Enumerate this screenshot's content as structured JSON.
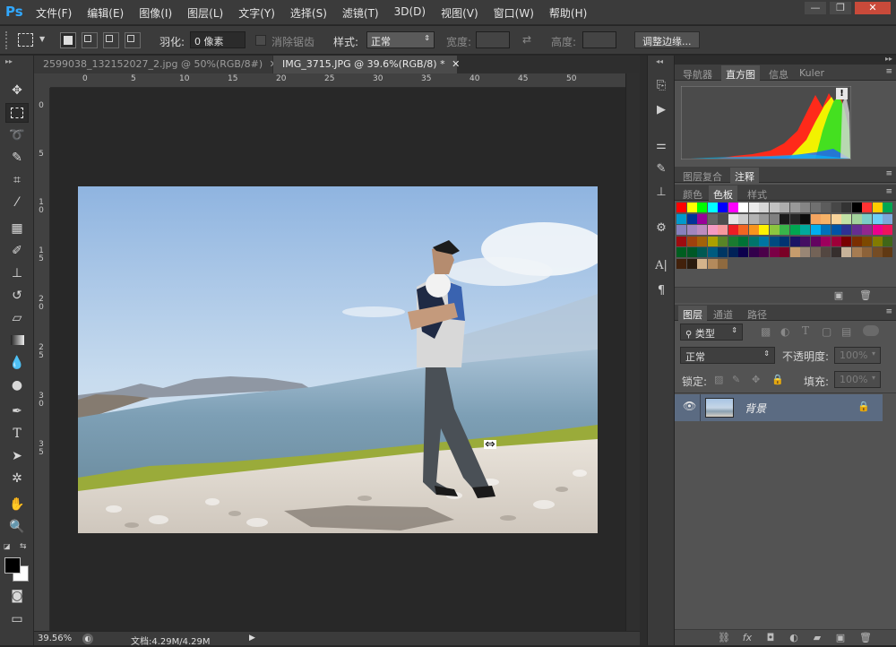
{
  "app": {
    "logo": "Ps"
  },
  "menu": [
    "文件(F)",
    "编辑(E)",
    "图像(I)",
    "图层(L)",
    "文字(Y)",
    "选择(S)",
    "滤镜(T)",
    "3D(D)",
    "视图(V)",
    "窗口(W)",
    "帮助(H)"
  ],
  "window_controls": {
    "minimize": "—",
    "restore": "❐",
    "close": "✕"
  },
  "options": {
    "feather_label": "羽化:",
    "feather_value": "0 像素",
    "antialias_label": "消除锯齿",
    "style_label": "样式:",
    "style_value": "正常",
    "width_label": "宽度:",
    "height_label": "高度:",
    "refine_button": "调整边缘..."
  },
  "doc_tabs": [
    {
      "label": "2599038_132152027_2.jpg @ 50%(RGB/8#)",
      "close": "✕",
      "active": false
    },
    {
      "label": "IMG_3715.JPG @ 39.6%(RGB/8) *",
      "close": "✕",
      "active": true
    }
  ],
  "ruler_h": [
    "0",
    "5",
    "10",
    "15",
    "20",
    "25",
    "30",
    "35",
    "40",
    "45",
    "50"
  ],
  "ruler_v": [
    [
      "0"
    ],
    [
      "5"
    ],
    [
      "1",
      "0"
    ],
    [
      "1",
      "5"
    ],
    [
      "2",
      "0"
    ],
    [
      "2",
      "5"
    ],
    [
      "3",
      "0"
    ],
    [
      "3",
      "5"
    ]
  ],
  "status": {
    "zoom": "39.56%",
    "doc_info": "文档:4.29M/4.29M"
  },
  "panels": {
    "top_tabs": [
      "导航器",
      "直方图",
      "信息",
      "Kuler"
    ],
    "top_active": "直方图",
    "histogram_warning": "!",
    "comp_tabs": [
      "图层复合",
      "注释"
    ],
    "comp_active": "注释",
    "swatch_tabs": [
      "颜色",
      "色板",
      "样式"
    ],
    "swatch_active": "色板",
    "layers_tabs": [
      "图层",
      "通道",
      "路径"
    ],
    "layers_active": "图层",
    "filter_kind": "类型",
    "blend_mode": "正常",
    "opacity_label": "不透明度:",
    "opacity_value": "100%",
    "lock_label": "锁定:",
    "fill_label": "填充:",
    "fill_value": "100%",
    "layer_name": "背景",
    "foot_icons": [
      "link-icon",
      "fx-icon",
      "mask-icon",
      "adjustment-icon",
      "folder-icon",
      "new-layer-icon",
      "trash-icon"
    ]
  },
  "swatches": [
    [
      "#ff0000",
      "#ffff00",
      "#00ff00",
      "#00ffff",
      "#0000ff",
      "#ff00ff",
      "#ffffff",
      "#ebebeb",
      "#d6d6d6",
      "#c2c2c2",
      "#adadad",
      "#999999",
      "#858585",
      "#707070",
      "#5c5c5c",
      "#474747",
      "#333333",
      "#000000",
      "#ff3333",
      "#ffcc00",
      "#00a651"
    ],
    [
      "#0099cc",
      "#003399",
      "#990099",
      "#666666",
      "#4d4d4d",
      "#e6e6e6",
      "#cccccc",
      "#b3b3b3",
      "#999999",
      "#808080",
      "#1a1a1a",
      "#262626",
      "#0d0d0d",
      "#f4a460",
      "#f7b267",
      "#f9d49b",
      "#c2e1a5",
      "#a3d39c",
      "#7accc8",
      "#6dcff6",
      "#7da7d9"
    ],
    [
      "#8781bd",
      "#a186be",
      "#bd8cbf",
      "#f49ac2",
      "#f6989d",
      "#ed1c24",
      "#f26522",
      "#f7941d",
      "#fff200",
      "#8dc63f",
      "#39b54a",
      "#00a651",
      "#00a99d",
      "#00aeef",
      "#0072bc",
      "#0054a6",
      "#2e3192",
      "#662d91",
      "#92278f",
      "#ec008c",
      "#ed145b"
    ],
    [
      "#9e0b0f",
      "#a0410d",
      "#a36209",
      "#aba000",
      "#598527",
      "#1a7b30",
      "#007236",
      "#00746b",
      "#0076a3",
      "#004b80",
      "#003471",
      "#1b1464",
      "#440e62",
      "#630460",
      "#9e005d",
      "#9e0039",
      "#790000",
      "#7b2e00",
      "#7d4900",
      "#827b00",
      "#406618"
    ],
    [
      "#005e20",
      "#005826",
      "#005952",
      "#005b7f",
      "#003663",
      "#002157",
      "#0d004c",
      "#32004b",
      "#4b0049",
      "#7b0046",
      "#7a0026",
      "#c69c6d",
      "#998675",
      "#736357",
      "#534741",
      "#362f2d",
      "#c7b299",
      "#a67c52",
      "#8c6239",
      "#754c24",
      "#603913"
    ],
    [
      "#42210b",
      "#2b1b0d",
      "#d4b38b",
      "#b38a5c",
      "#8f6a3f"
    ]
  ]
}
